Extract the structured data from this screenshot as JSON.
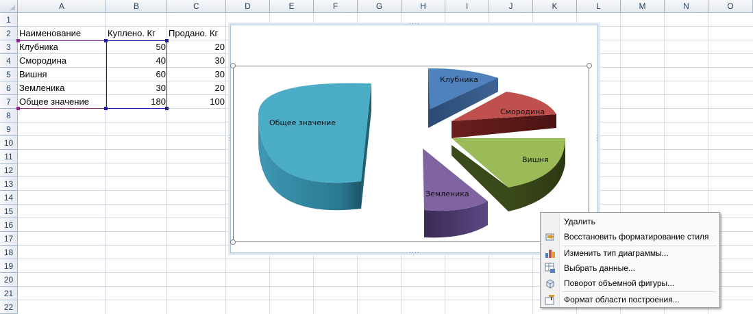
{
  "columns": [
    "A",
    "B",
    "C",
    "D",
    "E",
    "F",
    "G",
    "H",
    "I",
    "J",
    "K",
    "L",
    "M",
    "N",
    "O"
  ],
  "rows": [
    "1",
    "2",
    "3",
    "4",
    "5",
    "6",
    "7",
    "8",
    "9",
    "10",
    "11",
    "12",
    "13",
    "14",
    "15",
    "16",
    "17",
    "18",
    "19",
    "20",
    "21",
    "22"
  ],
  "table": {
    "headers": [
      "Наименование",
      "Куплено. Кг",
      "Продано. Кг"
    ],
    "rows": [
      {
        "name": "Клубника",
        "bought": "50",
        "sold": "20"
      },
      {
        "name": "Смородина",
        "bought": "40",
        "sold": "30"
      },
      {
        "name": "Вишня",
        "bought": "60",
        "sold": "30"
      },
      {
        "name": "Земленика",
        "bought": "30",
        "sold": "20"
      },
      {
        "name": "Общее значение",
        "bought": "180",
        "sold": "100"
      }
    ]
  },
  "chart_data": {
    "type": "pie",
    "title": "",
    "categories": [
      "Клубника",
      "Смородина",
      "Вишня",
      "Земленика",
      "Общее значение"
    ],
    "values": [
      50,
      40,
      60,
      30,
      180
    ],
    "colors": [
      "#4f81bd",
      "#c0504d",
      "#9bbb59",
      "#8064a2",
      "#4bacc6"
    ],
    "exploded": true,
    "three_d": true
  },
  "context_menu": {
    "items": [
      {
        "label": "Удалить",
        "icon": "none"
      },
      {
        "label": "Восстановить форматирование стиля",
        "icon": "reset-style-icon"
      },
      {
        "label": "Изменить тип диаграммы...",
        "icon": "chart-type-icon"
      },
      {
        "label": "Выбрать данные...",
        "icon": "select-data-icon"
      },
      {
        "label": "Поворот объемной фигуры...",
        "icon": "3d-rotation-icon"
      },
      {
        "label": "Формат области построения...",
        "icon": "format-plot-area-icon"
      }
    ]
  }
}
